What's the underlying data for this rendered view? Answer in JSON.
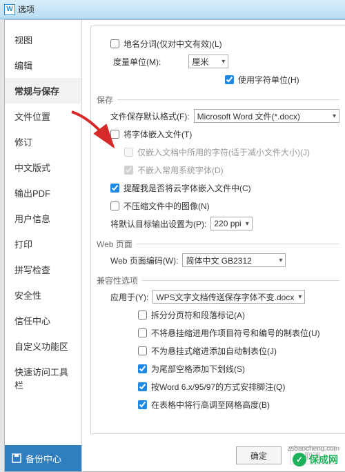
{
  "window": {
    "title": "选项"
  },
  "sidebar": {
    "items": [
      {
        "label": "视图"
      },
      {
        "label": "编辑"
      },
      {
        "label": "常规与保存"
      },
      {
        "label": "文件位置"
      },
      {
        "label": "修订"
      },
      {
        "label": "中文版式"
      },
      {
        "label": "输出PDF"
      },
      {
        "label": "用户信息"
      },
      {
        "label": "打印"
      },
      {
        "label": "拼写检查"
      },
      {
        "label": "安全性"
      },
      {
        "label": "信任中心"
      },
      {
        "label": "自定义功能区"
      },
      {
        "label": "快速访问工具栏"
      }
    ],
    "selectedIndex": 2,
    "backup_label": "备份中心"
  },
  "panel": {
    "place_name_fenci": "地名分词(仅对中文有效)(L)",
    "measure_unit_label": "度量单位(M):",
    "measure_unit_value": "厘米",
    "use_char_unit": "使用字符单位(H)",
    "section_save": "保存",
    "save_default_label": "文件保存默认格式(F):",
    "save_default_value": "Microsoft Word 文件(*.docx)",
    "embed_fonts": "将字体嵌入文件(T)",
    "embed_only_used": "仅嵌入文档中所用的字符(适于减小文件大小)(J)",
    "no_common_fonts": "不嵌入常用系统字体(D)",
    "remind_cloud_fonts": "提醒我是否将云字体嵌入文件中(C)",
    "no_compress_images": "不压缩文件中的图像(N)",
    "default_target_output_label": "将默认目标输出设置为(P):",
    "default_target_output_value": "220 ppi",
    "section_web": "Web 页面",
    "web_encoding_label": "Web 页面编码(W):",
    "web_encoding_value": "简体中文 GB2312",
    "section_compat": "兼容性选项",
    "apply_to_label": "应用于(Y):",
    "apply_to_value": "WPS文字文档传送保存字体不变.docx",
    "compat": [
      {
        "label": "拆分分页符和段落标记(A)",
        "checked": false
      },
      {
        "label": "不将悬挂缩进用作项目符号和编号的制表位(U)",
        "checked": false
      },
      {
        "label": "不为悬挂式缩进添加自动制表位(J)",
        "checked": false
      },
      {
        "label": "为尾部空格添加下划线(S)",
        "checked": true
      },
      {
        "label": "按Word 6.x/95/97的方式安排脚注(Q)",
        "checked": true
      },
      {
        "label": "在表格中将行高调至网格高度(B)",
        "checked": true
      }
    ]
  },
  "footer": {
    "ok": "确定",
    "cancel": "取消"
  },
  "watermark": {
    "text": "保成网",
    "url": "zsbaocheng.com"
  }
}
